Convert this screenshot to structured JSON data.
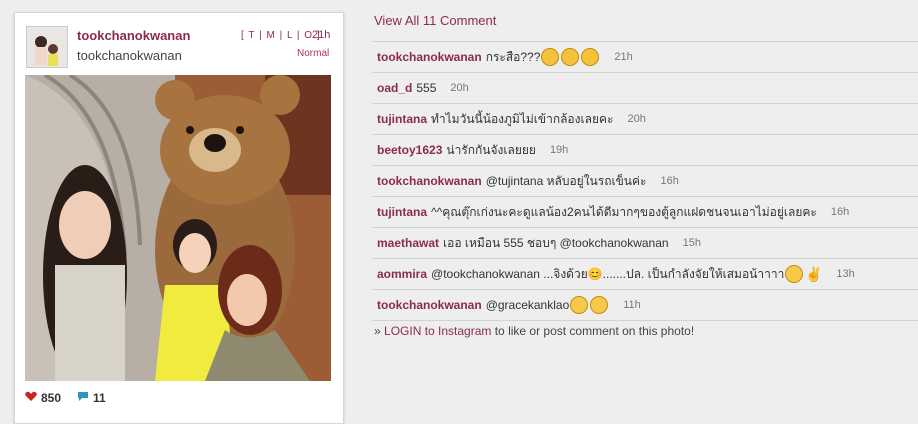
{
  "post": {
    "username": "tookchanokwanan",
    "fullname": "tookchanokwanan",
    "links": "[ T | M | L | O ]",
    "time": "21h",
    "filter": "Normal",
    "likes": "850",
    "comment_count": "11"
  },
  "comments_panel": {
    "view_all": "View All 11 Comment",
    "comments": [
      {
        "user": "tookchanokwanan",
        "text": "กระสือ???",
        "emoji": [
          "shock",
          "shock",
          "shock"
        ],
        "time": "21h"
      },
      {
        "user": "oad_d",
        "text": "555",
        "emoji": [],
        "time": "20h"
      },
      {
        "user": "tujintana",
        "text": "ทำไมวันนี้น้องภูมิไม่เข้ากล้องเลยคะ",
        "emoji": [],
        "time": "20h"
      },
      {
        "user": "beetoy1623",
        "text": "น่ารักกันจังเลยยย",
        "emoji": [],
        "time": "19h"
      },
      {
        "user": "tookchanokwanan",
        "text": "@tujintana หลับอยู่ในรถเข็นค่ะ",
        "emoji": [],
        "time": "16h"
      },
      {
        "user": "tujintana",
        "text": "^^คุณตุ๊กเก่งนะคะดูแลน้อง2คนได้ดีมากๆของตู้ลูกแฝดชนจนเอาไม่อยู่เลยคะ",
        "emoji": [],
        "time": "16h"
      },
      {
        "user": "maethawat",
        "text": "เออ เหมือน 555 ชอบๆ @tookchanokwanan",
        "emoji": [],
        "time": "15h"
      },
      {
        "user": "aommira",
        "text": "@tookchanokwanan ...จิงด้วย😊.......ปล. เป็นกำลังจัยให้เสมอน้าาาา",
        "emoji": [
          "love",
          "peace"
        ],
        "time": "13h"
      },
      {
        "user": "tookchanokwanan",
        "text": "@gracekanklao",
        "emoji": [
          "smile",
          "smile"
        ],
        "time": "11h"
      }
    ],
    "login_prefix": "» ",
    "login_link": "LOGIN to Instagram",
    "login_suffix": " to like or post comment on this photo!"
  }
}
